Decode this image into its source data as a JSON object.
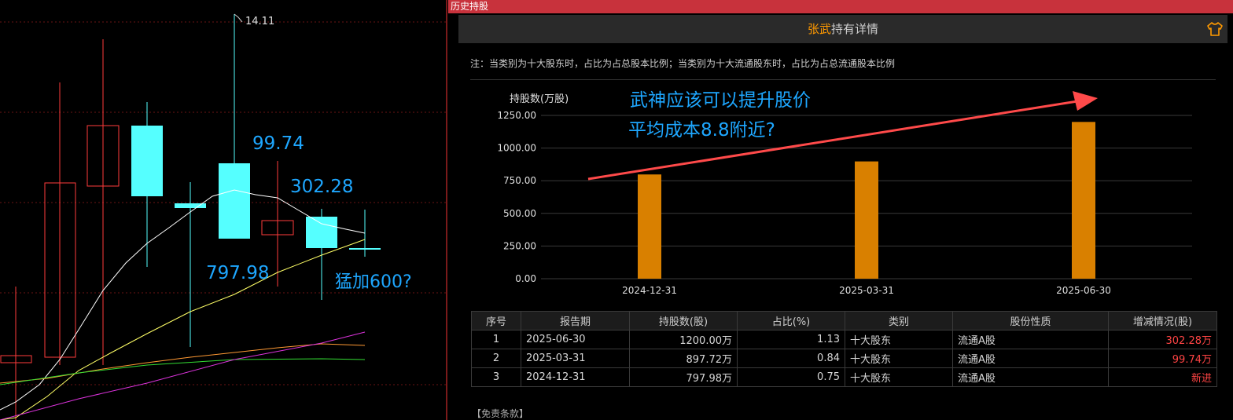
{
  "panel": {
    "title": "历史持股",
    "header_name": "张武",
    "header_suffix": "持有详情",
    "note": "注：当类别为十大股东时，占比为占总股本比例；当类别为十大流通股东时，占比为占总流通股本比例",
    "disclaimer": "【免责条款】"
  },
  "left_chart": {
    "high_label": "14.11",
    "annotations": [
      "99.74",
      "302.28",
      "797.98",
      "猛加600?"
    ]
  },
  "overlay_text": {
    "line1": "武神应该可以提升股价",
    "line2": "平均成本8.8附近?"
  },
  "chart_data": {
    "type": "bar",
    "ylabel": "持股数(万股)",
    "categories": [
      "2024-12-31",
      "2025-03-31",
      "2025-06-30"
    ],
    "values": [
      797.98,
      897.72,
      1200.0
    ],
    "ylim": [
      0,
      1250
    ],
    "yticks": [
      "0.00",
      "250.00",
      "500.00",
      "750.00",
      "1000.00",
      "1250.00"
    ],
    "grid": true,
    "bar_color": "#d98000"
  },
  "table": {
    "headers": [
      "序号",
      "报告期",
      "持股数(股)",
      "占比(%)",
      "类别",
      "股份性质",
      "增减情况(股)"
    ],
    "rows": [
      [
        "1",
        "2025-06-30",
        "1200.00万",
        "1.13",
        "十大股东",
        "流通A股",
        "302.28万"
      ],
      [
        "2",
        "2025-03-31",
        "897.72万",
        "0.84",
        "十大股东",
        "流通A股",
        "99.74万"
      ],
      [
        "3",
        "2024-12-31",
        "797.98万",
        "0.75",
        "十大股东",
        "流通A股",
        "新进"
      ]
    ]
  },
  "colors": {
    "title_bar": "#c8323c",
    "candle_up": "#ff3b3b",
    "candle_down": "#55ffff",
    "annotation": "#1ea7ff",
    "accent_name": "#ff9900",
    "arrow": "#ff4a4a"
  },
  "icons": [
    "shirt-icon"
  ]
}
